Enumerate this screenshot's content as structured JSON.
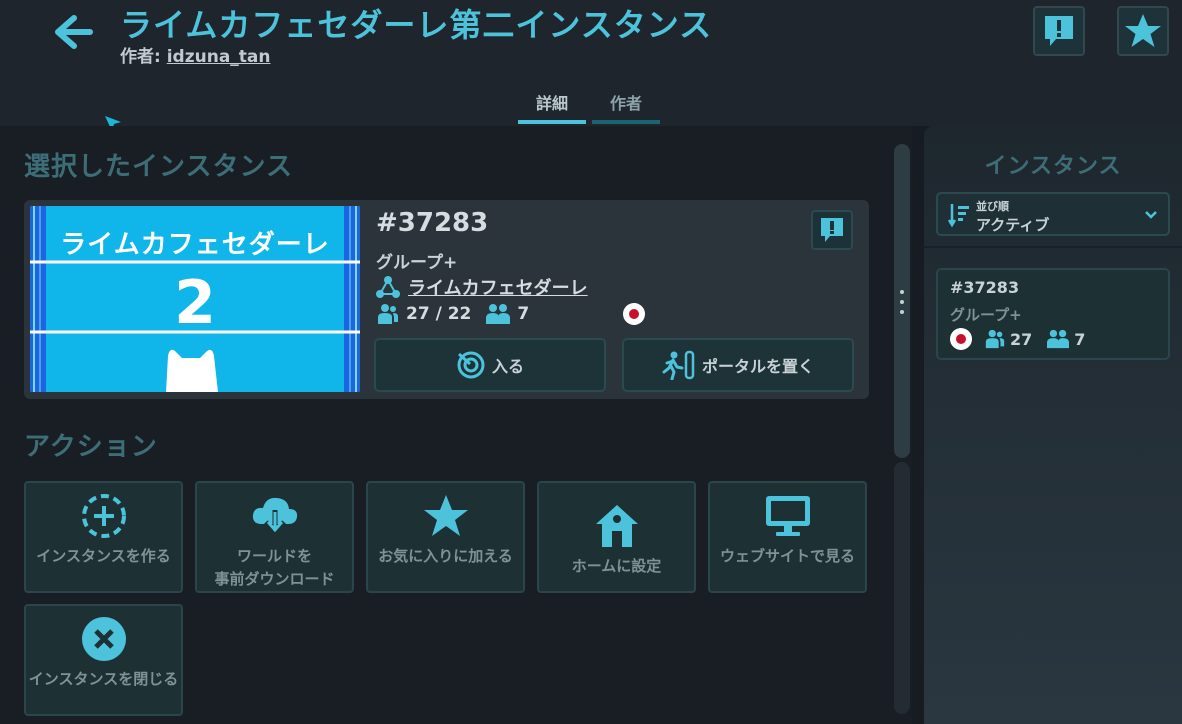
{
  "header": {
    "title": "ライムカフェセダーレ第二インスタンス",
    "author_label": "作者:",
    "author_name": "idzuna_tan"
  },
  "tabs": [
    {
      "label": "詳細",
      "active": true
    },
    {
      "label": "作者",
      "active": false
    }
  ],
  "selected": {
    "section_title": "選択したインスタンス",
    "thumbnail": {
      "name": "ライムカフェセダーレ",
      "number": "2"
    },
    "instance_id": "#37283",
    "instance_type": "グループ+",
    "group_name": "ライムカフェセダーレ",
    "users": "27 / 22",
    "friends": "7",
    "region_flag": "Japan",
    "join_label": "入る",
    "portal_label": "ポータルを置く"
  },
  "actions": {
    "section_title": "アクション",
    "items": [
      {
        "label": "インスタンスを作る",
        "icon": "add-circle-icon"
      },
      {
        "label": "ワールドを\n事前ダウンロード",
        "icon": "cloud-download-icon"
      },
      {
        "label": "お気に入りに加える",
        "icon": "star-icon"
      },
      {
        "label": "ホームに設定",
        "icon": "home-icon"
      },
      {
        "label": "ウェブサイトで見る",
        "icon": "monitor-icon"
      },
      {
        "label": "インスタンスを閉じる",
        "icon": "close-circle-icon"
      }
    ]
  },
  "sidebar": {
    "title": "インスタンス",
    "sort_label": "並び順",
    "sort_value": "アクティブ",
    "instances": [
      {
        "id": "#37283",
        "type": "グループ+",
        "users": "27",
        "friends": "7"
      }
    ]
  },
  "colors": {
    "accent": "#4cc3db",
    "background": "#171c22",
    "card": "#2c343b",
    "thumbnail": "#10b6ea"
  }
}
